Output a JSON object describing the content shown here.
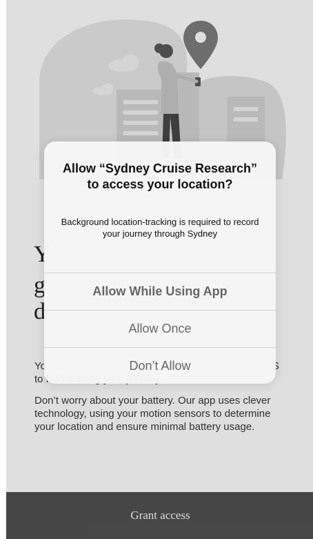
{
  "alert": {
    "title": "Allow “Sydney Cruise Research” to access your location?",
    "message": "Background location-tracking is required to record your journey through Sydney",
    "buttons": {
      "allow_while_using": "Allow While Using App",
      "allow_once": "Allow Once",
      "dont_allow": "Don’t Allow"
    }
  },
  "background": {
    "heading_lines": [
      "Y",
      "g",
      "d"
    ],
    "para1_start": "Yo",
    "para1_tail": "S",
    "para1_line2": "to follow along your journey.",
    "para2": "Don’t worry about your battery. Our app uses clever technology, using your motion sensors to determine your location and ensure minimal battery usage."
  },
  "footer": {
    "grant_label": "Grant access"
  },
  "icons": [
    "location-pin-icon",
    "cloud-icon",
    "person-illustration",
    "building-illustration"
  ]
}
